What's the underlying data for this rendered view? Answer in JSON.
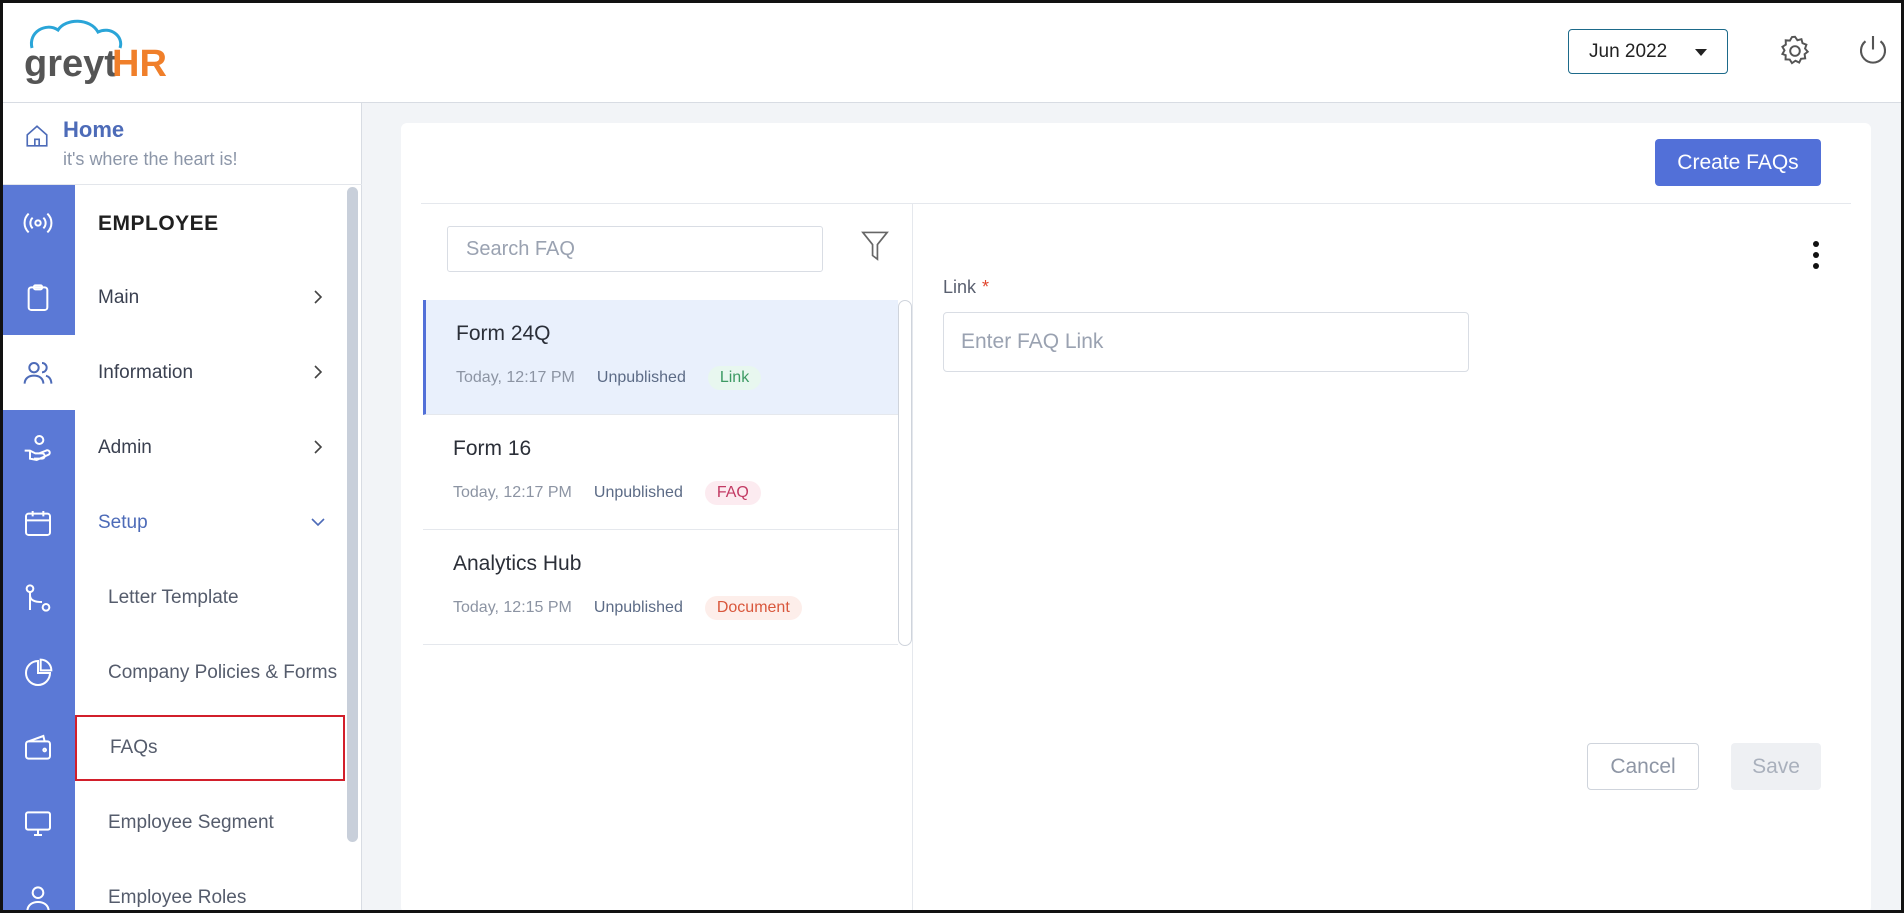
{
  "header": {
    "logo_text_a": "greyt",
    "logo_text_b": "HR",
    "period": "Jun 2022",
    "icons": [
      "settings-gear-icon",
      "power-icon"
    ]
  },
  "sidebar": {
    "home_title": "Home",
    "home_subtitle": "it's where the heart is!",
    "section_title": "EMPLOYEE",
    "rail_icons": [
      "broadcast-icon",
      "clipboard-icon",
      "people-icon",
      "hand-heart-icon",
      "calendar-icon",
      "git-flow-icon",
      "pie-chart-icon",
      "wallet-icon",
      "monitor-icon",
      "person-icon"
    ],
    "menu": [
      {
        "label": "Main"
      },
      {
        "label": "Information"
      },
      {
        "label": "Admin"
      },
      {
        "label": "Setup"
      }
    ],
    "submenu": [
      {
        "label": "Letter Template"
      },
      {
        "label": "Company Policies & Forms"
      },
      {
        "label": "FAQs"
      },
      {
        "label": "Employee Segment"
      },
      {
        "label": "Employee Roles"
      }
    ]
  },
  "main": {
    "create_button": "Create FAQs",
    "search_placeholder": "Search FAQ",
    "faqs": [
      {
        "title": "Form 24Q",
        "time": "Today, 12:17 PM",
        "status": "Unpublished",
        "type": "Link"
      },
      {
        "title": "Form 16",
        "time": "Today, 12:17 PM",
        "status": "Unpublished",
        "type": "FAQ"
      },
      {
        "title": "Analytics Hub",
        "time": "Today, 12:15 PM",
        "status": "Unpublished",
        "type": "Document"
      }
    ],
    "detail": {
      "field_label": "Link",
      "required_mark": "*",
      "link_placeholder": "Enter FAQ Link",
      "cancel_label": "Cancel",
      "save_label": "Save"
    }
  },
  "colors": {
    "accent": "#5270d8",
    "rail": "#5b79d6",
    "selected_outline": "#d21f2b"
  }
}
